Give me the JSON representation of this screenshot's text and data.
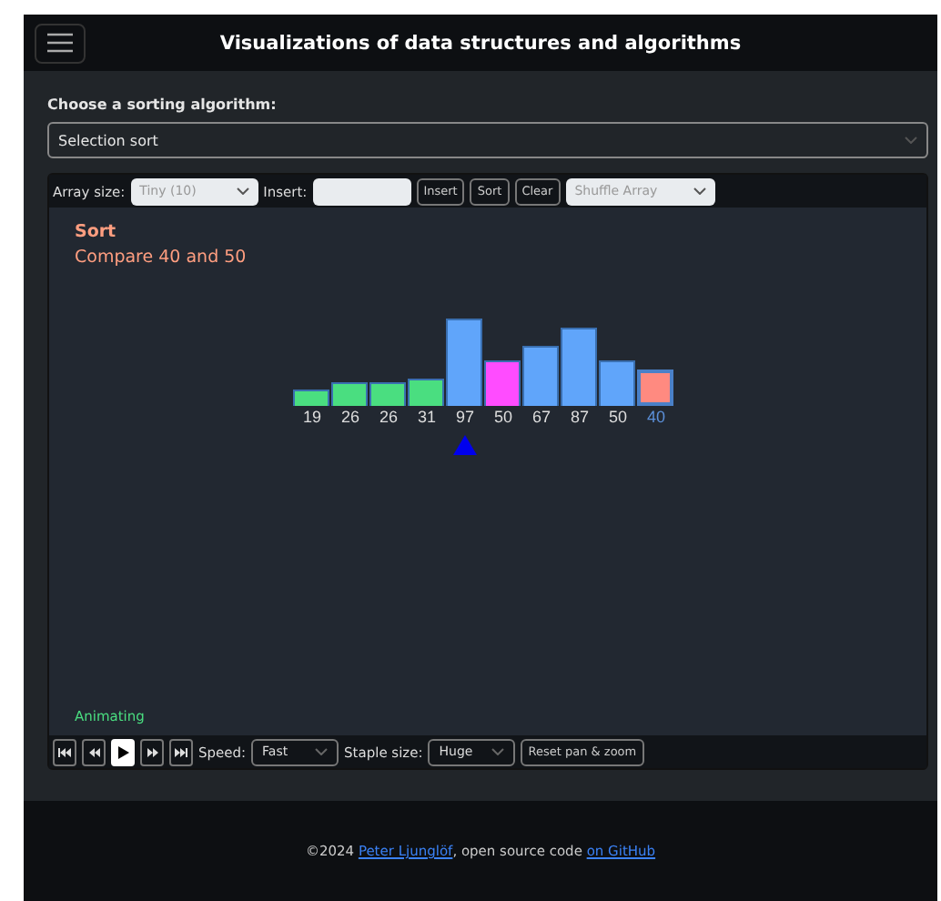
{
  "header": {
    "title": "Visualizations of data structures and algorithms"
  },
  "algorithm": {
    "label": "Choose a sorting algorithm:",
    "value": "Selection sort"
  },
  "toolbar": {
    "size_label": "Array size:",
    "size_value": "Tiny (10)",
    "size_disabled": true,
    "insert_label": "Insert:",
    "insert_disabled": true,
    "buttons": [
      "Insert",
      "Sort",
      "Clear"
    ],
    "shuffle_value": "Shuffle Array",
    "shuffle_disabled": true
  },
  "canvas": {
    "title": "Sort",
    "message": "Compare 40 and 50",
    "status": "Animating",
    "items": [
      {
        "value": "19",
        "kind": "sorted",
        "pointer": false
      },
      {
        "value": "26",
        "kind": "sorted",
        "pointer": false
      },
      {
        "value": "26",
        "kind": "sorted",
        "pointer": false
      },
      {
        "value": "31",
        "kind": "sorted",
        "pointer": false
      },
      {
        "value": "97",
        "kind": "normal",
        "pointer": true
      },
      {
        "value": "50",
        "kind": "compare",
        "pointer": false
      },
      {
        "value": "67",
        "kind": "normal",
        "pointer": false
      },
      {
        "value": "87",
        "kind": "normal",
        "pointer": false
      },
      {
        "value": "50",
        "kind": "normal",
        "pointer": false
      },
      {
        "value": "40",
        "kind": "current",
        "pointer": false
      }
    ]
  },
  "controls": {
    "playback": [
      {
        "kind": "first",
        "on": false
      },
      {
        "kind": "back",
        "on": false
      },
      {
        "kind": "play",
        "on": true
      },
      {
        "kind": "forward",
        "on": false
      },
      {
        "kind": "last",
        "on": false
      }
    ],
    "speed_label": "Speed:",
    "speed_value": "Fast",
    "staple_label": "Staple size:",
    "staple_value": "Huge",
    "reset": "Reset pan & zoom"
  },
  "footer": {
    "prefix": "©2024 ",
    "author": "Peter Ljunglöf",
    "middle": ", open source code ",
    "link": "on GitHub"
  }
}
